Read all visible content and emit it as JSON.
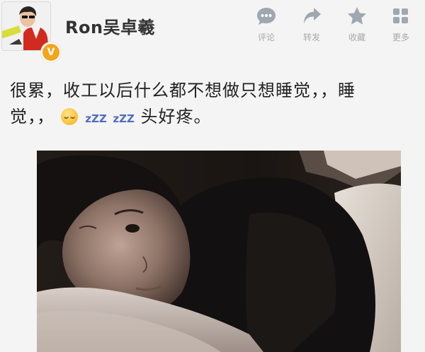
{
  "user": {
    "name": "Ron吴卓羲",
    "verified_badge": "V",
    "verified_color": "#f3a51b"
  },
  "actions": [
    {
      "label": "评论",
      "icon": "comment-icon"
    },
    {
      "label": "转发",
      "icon": "repost-icon"
    },
    {
      "label": "收藏",
      "icon": "star-icon"
    },
    {
      "label": "更多",
      "icon": "more-icon"
    }
  ],
  "post": {
    "line1": "很累，收工以后什么都不想做只想睡觉，，睡",
    "line2_before": "觉，，",
    "emoji": "sleepy-face-emoji",
    "zzz1": "zZZ",
    "zzz2": "zZZ",
    "line2_after": "头好疼。"
  },
  "colors": {
    "icon": "#9fa7b0",
    "text": "#222222",
    "username": "#333333",
    "action_label": "#a8a8a8",
    "background": "#f4f4f4"
  }
}
